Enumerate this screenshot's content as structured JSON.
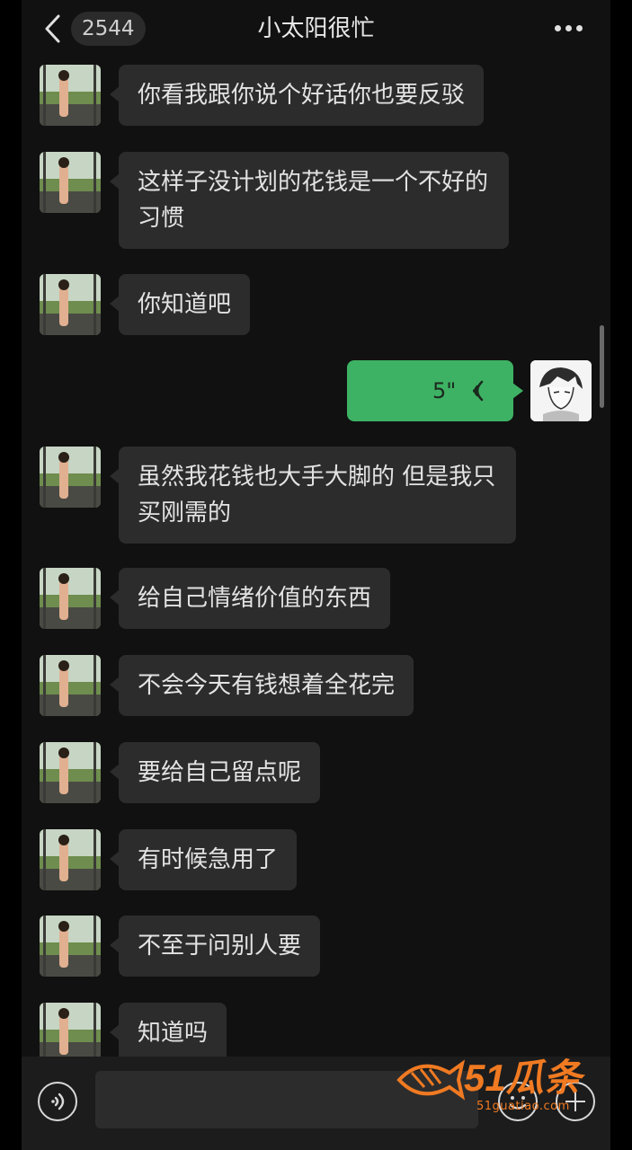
{
  "header": {
    "back_icon": "chevron-left-icon",
    "unread_count": "2544",
    "title": "小太阳很忙",
    "more_icon": "more-icon"
  },
  "messages": [
    {
      "sender": "other",
      "text": "你看我跟你说个好话你也要反驳"
    },
    {
      "sender": "other",
      "text": "这样子没计划的花钱是一个不好的习惯"
    },
    {
      "sender": "other",
      "text": "你知道吧"
    },
    {
      "sender": "self",
      "type": "voice",
      "duration": "5\""
    },
    {
      "sender": "other",
      "text": "虽然我花钱也大手大脚的 但是我只买刚需的"
    },
    {
      "sender": "other",
      "text": "给自己情绪价值的东西"
    },
    {
      "sender": "other",
      "text": "不会今天有钱想着全花完"
    },
    {
      "sender": "other",
      "text": "要给自己留点呢"
    },
    {
      "sender": "other",
      "text": "有时候急用了"
    },
    {
      "sender": "other",
      "text": "不至于问别人要"
    },
    {
      "sender": "other",
      "text": "知道吗"
    }
  ],
  "input_bar": {
    "voice_icon": "voice-input-icon",
    "emoji_icon": "emoji-icon",
    "plus_icon": "plus-icon"
  },
  "watermark": {
    "text": "51瓜条",
    "url": "51guatiao.com"
  },
  "colors": {
    "background": "#111111",
    "incoming_bubble": "#2c2c2c",
    "outgoing_bubble": "#3eb264",
    "watermark": "#f07a22"
  }
}
